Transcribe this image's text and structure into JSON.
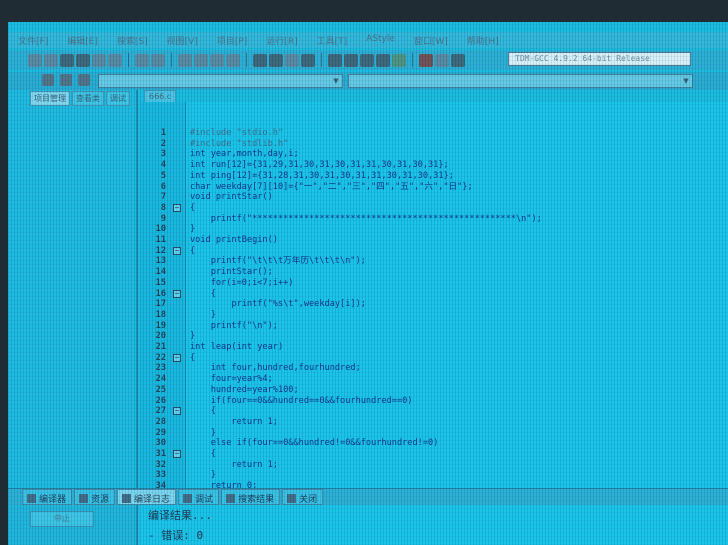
{
  "menubar": {
    "items": [
      "文件[F]",
      "编辑[E]",
      "搜索[S]",
      "视图[V]",
      "项目[P]",
      "运行[R]",
      "工具[T]",
      "AStyle",
      "窗口[W]",
      "帮助[H]"
    ]
  },
  "toolbar": {
    "compiler": "TDM-GCC 4.9.2 64-bit Release"
  },
  "left_panel": {
    "tabs": [
      "项目管理",
      "查看类",
      "调试"
    ]
  },
  "editor": {
    "tab_label": "666.c",
    "lines": [
      "#include \"stdio.h\"",
      "#include \"stdlib.h\"",
      "int year,month,day,i;",
      "int run[12]={31,29,31,30,31,30,31,31,30,31,30,31};",
      "int ping[12]={31,28,31,30,31,30,31,31,30,31,30,31};",
      "char weekday[7][10]={\"一\",\"二\",\"三\",\"四\",\"五\",\"六\",\"日\"};",
      "void printStar()",
      "{",
      "    printf(\"***************************************************\\n\");",
      "}",
      "void printBegin()",
      "{",
      "    printf(\"\\t\\t\\t万年历\\t\\t\\t\\n\");",
      "    printStar();",
      "    for(i=0;i<7;i++)",
      "    {",
      "        printf(\"%s\\t\",weekday[i]);",
      "    }",
      "    printf(\"\\n\");",
      "}",
      "int leap(int year)",
      "{",
      "    int four,hundred,fourhundred;",
      "    four=year%4;",
      "    hundred=year%100;",
      "    if(four==0&&hundred==0&&fourhundred==0)",
      "    {",
      "        return 1;",
      "    }",
      "    else if(four==0&&hundred!=0&&fourhundred!=0)",
      "    {",
      "        return 1;",
      "    }",
      "    return 0;",
      "}"
    ]
  },
  "bottom_tabs": [
    "编译器",
    "资源",
    "编译日志",
    "调试",
    "搜索结果",
    "关闭"
  ],
  "bottom_left": {
    "stop_label": "中止"
  },
  "output": {
    "lines": [
      "编译结果...",
      "- 错误: 0"
    ]
  }
}
